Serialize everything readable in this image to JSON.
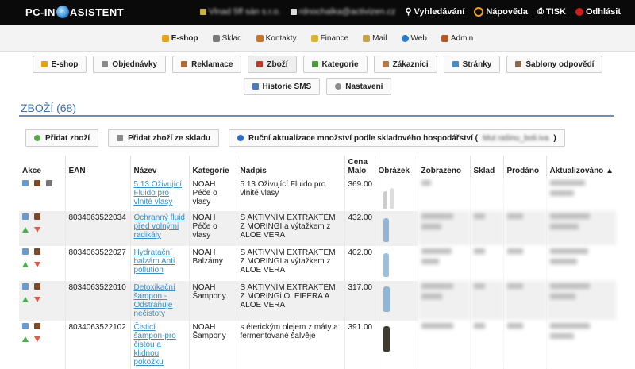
{
  "app": {
    "logo_left": "PC-IN",
    "logo_right": "ASISTENT",
    "company_blurred": "Vlnad 5ff sán s.r.o.",
    "email_blurred": "rdnochalka@activizen.cz",
    "search_label": "Vyhledávání",
    "help_label": "Nápověda",
    "print_label": "TISK",
    "logout_label": "Odhlásit"
  },
  "main_nav": [
    {
      "label": "E-shop",
      "icon": "lock-icon",
      "color": "#e3a21a",
      "active": true
    },
    {
      "label": "Sklad",
      "icon": "wrench-icon",
      "color": "#7a7a7a"
    },
    {
      "label": "Kontakty",
      "icon": "contacts-icon",
      "color": "#c8742a"
    },
    {
      "label": "Finance",
      "icon": "finance-icon",
      "color": "#d9b334"
    },
    {
      "label": "Mail",
      "icon": "mail-icon",
      "color": "#c9a24a"
    },
    {
      "label": "Web",
      "icon": "globe-icon",
      "color": "#2a7ac8"
    },
    {
      "label": "Admin",
      "icon": "admin-icon",
      "color": "#b05a2a"
    }
  ],
  "sub_nav": [
    {
      "label": "E-shop",
      "icon": "lock-icon",
      "color": "#e3a21a"
    },
    {
      "label": "Objednávky",
      "icon": "orders-icon",
      "color": "#8a8a8a"
    },
    {
      "label": "Reklamace",
      "icon": "hammer-icon",
      "color": "#b06a3a"
    },
    {
      "label": "Zboží",
      "icon": "goods-icon",
      "color": "#c0392b",
      "selected": true
    },
    {
      "label": "Kategorie",
      "icon": "category-icon",
      "color": "#4a9a3a"
    },
    {
      "label": "Zákazníci",
      "icon": "customers-icon",
      "color": "#b07a4a"
    },
    {
      "label": "Stránky",
      "icon": "pages-icon",
      "color": "#4a8ac8"
    },
    {
      "label": "Šablony odpovědí",
      "icon": "templates-icon",
      "color": "#8a6a4a"
    },
    {
      "label": "Historie SMS",
      "icon": "sms-icon",
      "color": "#4a7ab8"
    },
    {
      "label": "Nastavení",
      "icon": "gear-icon",
      "color": "#8a8a8a"
    }
  ],
  "heading": "ZBOŽÍ (68)",
  "actions": {
    "add_product": "Přidat zboží",
    "add_from_stock": "Přidat zboží ze skladu",
    "manual_update": "Ruční aktualizace množství podle skladového hospodářství (",
    "manual_update_blurred": "Mut rašinu_boli.iva",
    "manual_update_end": ")"
  },
  "table": {
    "columns": [
      "Akce",
      "EAN",
      "Název",
      "Kategorie",
      "Nadpis",
      "Cena Malo",
      "Obrázek",
      "Zobrazeno",
      "Sklad",
      "Prodáno",
      "Aktualizováno ▲"
    ],
    "rows": [
      {
        "ean": "",
        "name": "5.13 Oživující Fluido pro vlnité vlasy",
        "category": "NOAH Péče o vlasy",
        "title": "5.13 Oživující Fluido pro vlnité vlasy",
        "price": "369.00"
      },
      {
        "ean": "8034063522034",
        "name": "Ochranný fluid před volnými radikály",
        "category": "NOAH Péče o vlasy",
        "title": "S AKTIVNÍM EXTRAKTEM Z MORINGI a výtažkem z ALOE VERA",
        "price": "432.00"
      },
      {
        "ean": "8034063522027",
        "name": "Hydratační balzám Anti pollution",
        "category": "NOAH Balzámy",
        "title": "S AKTIVNÍM EXTRAKTEM Z MORINGI a výtažkem z ALOE VERA",
        "price": "402.00"
      },
      {
        "ean": "8034063522010",
        "name": "Detoxikační šampon - Odstraňuje nečistoty",
        "category": "NOAH Šampony",
        "title": "S AKTIVNÍM EXTRAKTEM Z MORINGi OLEIFERA A ALOE VERA",
        "price": "317.00"
      },
      {
        "ean": "8034063522102",
        "name": "Čisticí šampon-pro čistou a klidnou pokožku",
        "category": "NOAH Šampony",
        "title": "s éterickým olejem z máty a fermentované šalvěje",
        "price": "391.00"
      }
    ]
  }
}
